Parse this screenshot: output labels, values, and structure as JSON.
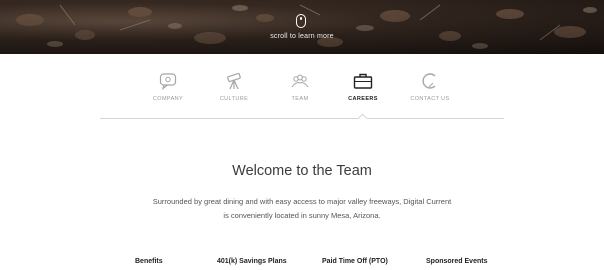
{
  "hero": {
    "caption": "scroll to learn more",
    "scroll_icon": "mouse-icon"
  },
  "nav": {
    "items": [
      {
        "label": "COMPANY",
        "icon": "speech-bubble-icon",
        "active": false
      },
      {
        "label": "CULTURE",
        "icon": "telescope-icon",
        "active": false
      },
      {
        "label": "TEAM",
        "icon": "team-icon",
        "active": false
      },
      {
        "label": "CAREERS",
        "icon": "briefcase-icon",
        "active": true
      },
      {
        "label": "CONTACT US",
        "icon": "contact-c-icon",
        "active": false
      }
    ]
  },
  "main": {
    "title": "Welcome to the Team",
    "intro": "Surrounded by great dining and with easy access to major valley freeways, Digital Current is conveniently located in sunny Mesa, Arizona.",
    "benefits": [
      "Benefits",
      "401(k) Savings Plans",
      "Paid Time Off (PTO)",
      "Sponsored Events"
    ]
  },
  "colors": {
    "hero_dark": "#1e1612",
    "nav_inactive": "#9a9a9a",
    "nav_active": "#222222",
    "rule": "#d6d6d6"
  }
}
